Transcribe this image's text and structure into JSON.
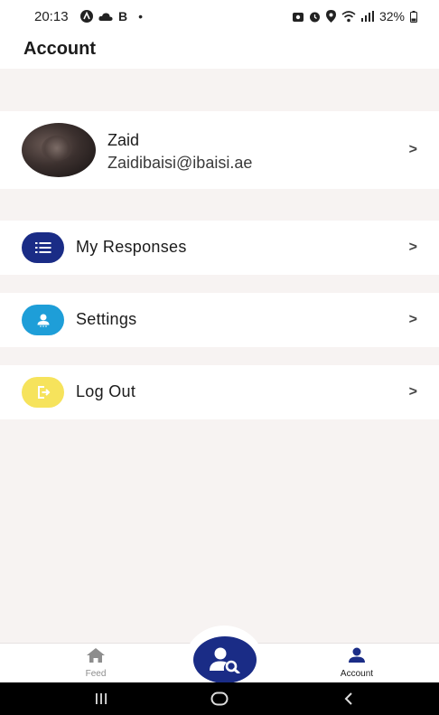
{
  "status_bar": {
    "time": "20:13",
    "left_icons": [
      "notification-a-icon",
      "cloud-icon",
      "b-icon",
      "dot-icon"
    ],
    "right_icons": [
      "camera-icon",
      "alarm-icon",
      "location-icon",
      "wifi-icon",
      "signal-icon"
    ],
    "battery": "32%"
  },
  "header": {
    "title": "Account"
  },
  "profile": {
    "name": "Zaid",
    "email": "Zaidibaisi@ibaisi.ae",
    "chevron": ">"
  },
  "menu": {
    "items": [
      {
        "label": "My Responses",
        "icon": "list-icon",
        "icon_color": "#1a2c86",
        "chevron": ">"
      },
      {
        "label": "Settings",
        "icon": "user-settings-icon",
        "icon_color": "#1e9ed8",
        "chevron": ">"
      },
      {
        "label": "Log Out",
        "icon": "logout-icon",
        "icon_color": "#f6e35c",
        "chevron": ">"
      }
    ]
  },
  "bottom_nav": {
    "feed_label": "Feed",
    "account_label": "Account",
    "center_icon": "user-search-icon",
    "active": "Account",
    "accent": "#1a2c86"
  },
  "system_nav": {
    "buttons": [
      "recents-icon",
      "home-icon",
      "back-icon"
    ]
  }
}
